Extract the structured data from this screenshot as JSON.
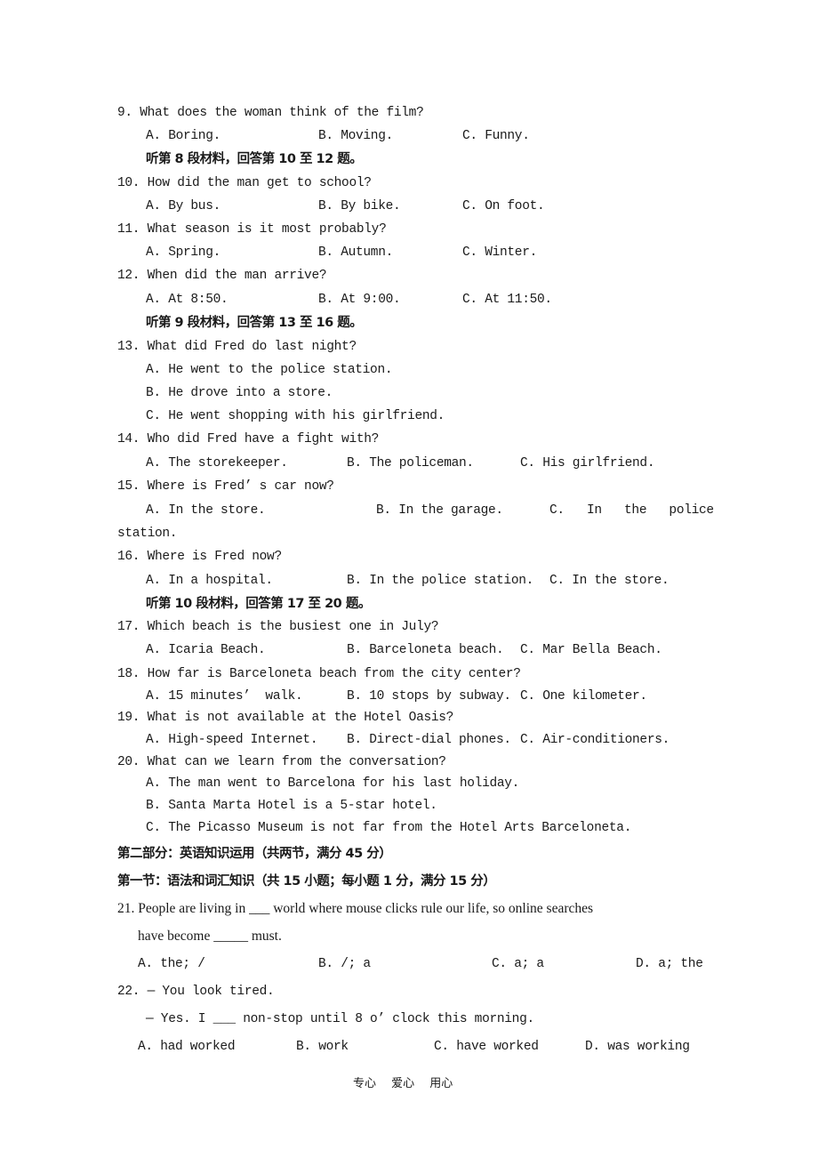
{
  "q9": {
    "num": "9.",
    "text": "What does the woman think of the film?",
    "a": "A. Boring.",
    "b": "B. Moving.",
    "c": "C. Funny."
  },
  "h8": "听第 8 段材料，回答第 10 至 12 题。",
  "q10": {
    "num": "10.",
    "text": "How did the man get to school?",
    "a": "A. By bus.",
    "b": "B. By bike.",
    "c": "C. On foot."
  },
  "q11": {
    "num": "11.",
    "text": "What season is it most probably?",
    "a": "A. Spring.",
    "b": "B. Autumn.",
    "c": "C. Winter."
  },
  "q12": {
    "num": "12.",
    "text": "When did the man arrive?",
    "a": "A. At 8:50.",
    "b": "B. At 9:00.",
    "c": "C. At 11:50."
  },
  "h9": "听第 9 段材料，回答第 13 至 16 题。",
  "q13": {
    "num": "13.",
    "text": "What did Fred do last night?",
    "a": "A. He went to the police station.",
    "b": "B. He drove into a store.",
    "c": "C. He went shopping with his girlfriend."
  },
  "q14": {
    "num": "14.",
    "text": "Who did Fred have a fight with?",
    "a": "A. The storekeeper.",
    "b": "B. The policeman.",
    "c": "C. His girlfriend."
  },
  "q15": {
    "num": "15.",
    "text": "Where is Fred’ s car now?",
    "a": "A. In the store.",
    "b": "B. In the garage.",
    "c": "C.   In   the   police",
    "c_cont": "station."
  },
  "q16": {
    "num": "16.",
    "text": "Where is Fred now?",
    "a": "A. In a hospital.",
    "b": "B. In the police station.",
    "c": "C. In the store."
  },
  "h10": "听第 10 段材料，回答第 17 至 20 题。",
  "q17": {
    "num": "17.",
    "text": "Which beach is the busiest one in July?",
    "a": "A. Icaria Beach.",
    "b": "B. Barceloneta beach.",
    "c": "C. Mar Bella Beach."
  },
  "q18": {
    "num": "18.",
    "text": "How far is Barceloneta beach from the city center?",
    "a": "A. 15 minutes’  walk.",
    "b": "B. 10 stops by subway.",
    "c": "C. One kilometer."
  },
  "q19": {
    "num": "19.",
    "text": "What is not available at the Hotel Oasis?",
    "a": "A. High-speed Internet.",
    "b": "B. Direct-dial phones.",
    "c": "C. Air-conditioners."
  },
  "q20": {
    "num": "20.",
    "text": "What can we learn from the conversation?",
    "a": "A. The man went to Barcelona for his last holiday.",
    "b": "B. Santa Marta Hotel is a 5-star hotel.",
    "c": "C. The Picasso Museum is not far from the Hotel Arts Barceloneta."
  },
  "part2": "第二部分：英语知识运用（共两节，满分 45 分）",
  "sec1": "第一节：语法和词汇知识（共 15 小题；每小题 1 分，满分 15 分）",
  "q21": {
    "line1": "21. People are living in ___ world where mouse clicks rule our life, so online searches",
    "line2": "have become _____ must.",
    "a": "A. the; /",
    "b": "B. /; a",
    "c": "C. a; a",
    "d": "D. a; the"
  },
  "q22": {
    "line1": "22. — You look tired.",
    "line2": "— Yes. I ___ non-stop until 8 o’ clock this morning.",
    "a": "A. had worked",
    "b": "B. work",
    "c": "C. have worked",
    "d": "D. was working"
  },
  "footer": "专心　 爱心　 用心"
}
